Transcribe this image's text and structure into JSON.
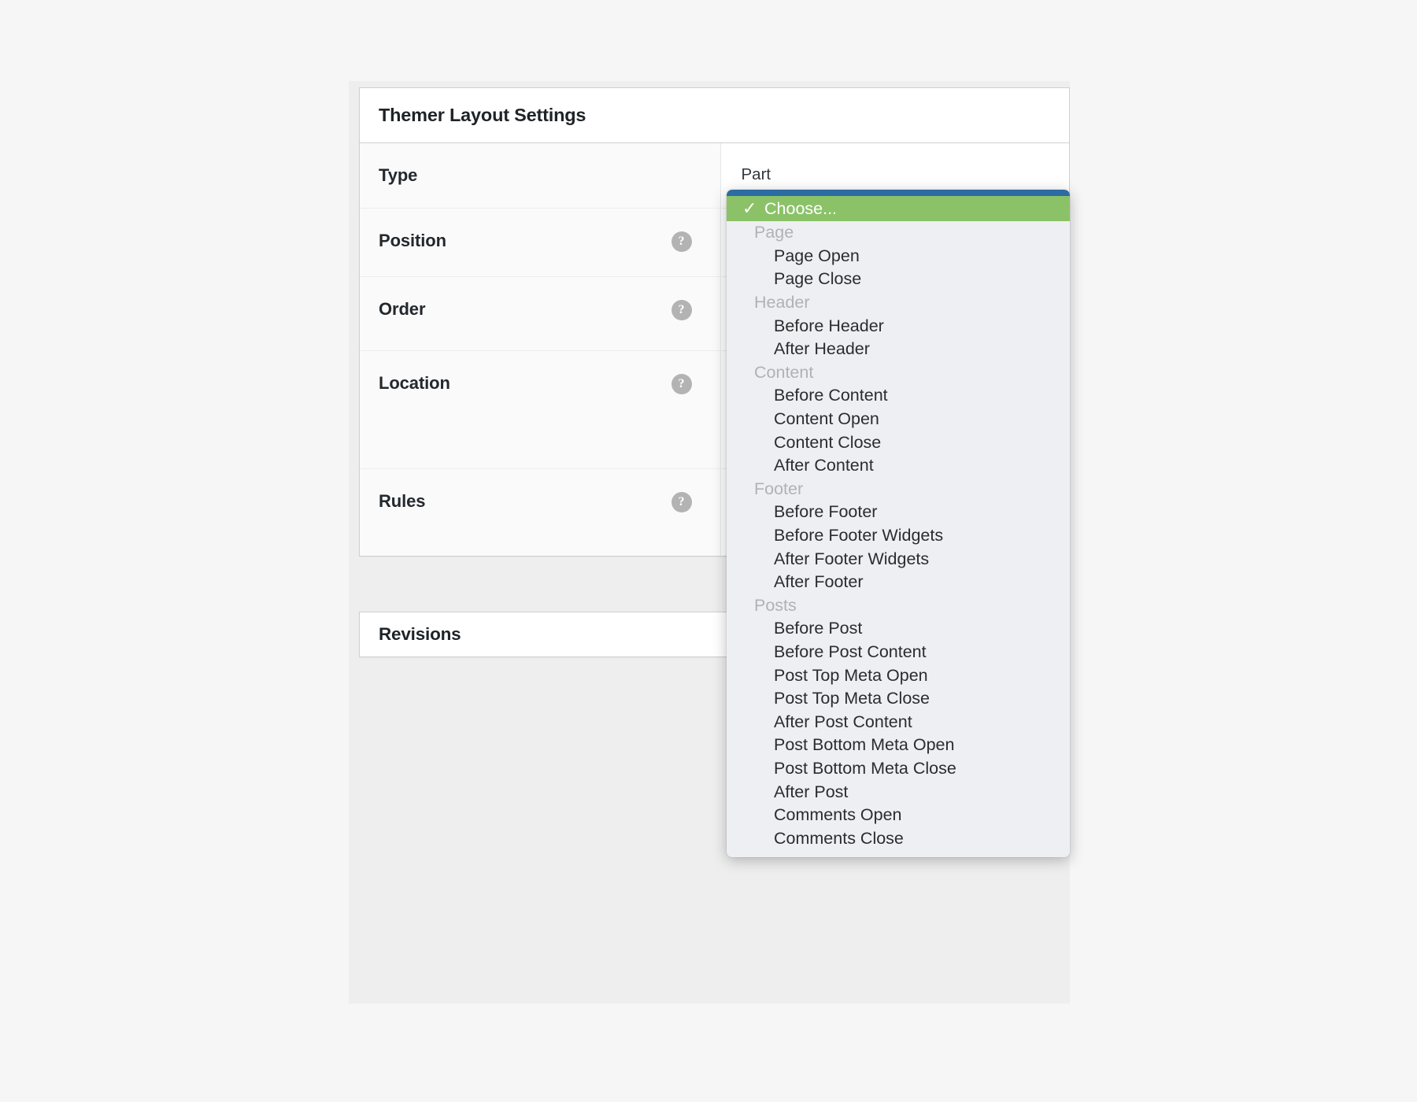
{
  "panel": {
    "title": "Themer Layout Settings",
    "rows": [
      {
        "label": "Type",
        "value": "Part",
        "has_help": false,
        "help_icon": "question-mark-circle-icon"
      },
      {
        "label": "Position",
        "value": "",
        "has_help": true,
        "help_icon": "question-mark-circle-icon"
      },
      {
        "label": "Order",
        "value": "",
        "has_help": true,
        "help_icon": "question-mark-circle-icon"
      },
      {
        "label": "Location",
        "value": "",
        "has_help": true,
        "help_icon": "question-mark-circle-icon"
      },
      {
        "label": "Rules",
        "value": "",
        "has_help": true,
        "help_icon": "question-mark-circle-icon"
      }
    ]
  },
  "revisions": {
    "title": "Revisions"
  },
  "dropdown": {
    "selected_label": "Choose...",
    "check_glyph": "✓",
    "options": [
      {
        "label": "Choose...",
        "type": "selected"
      },
      {
        "label": "Page",
        "type": "group"
      },
      {
        "label": "Page Open",
        "type": "item"
      },
      {
        "label": "Page Close",
        "type": "item"
      },
      {
        "label": "Header",
        "type": "group"
      },
      {
        "label": "Before Header",
        "type": "item"
      },
      {
        "label": "After Header",
        "type": "item"
      },
      {
        "label": "Content",
        "type": "group"
      },
      {
        "label": "Before Content",
        "type": "item"
      },
      {
        "label": "Content Open",
        "type": "item"
      },
      {
        "label": "Content Close",
        "type": "item"
      },
      {
        "label": "After Content",
        "type": "item"
      },
      {
        "label": "Footer",
        "type": "group"
      },
      {
        "label": "Before Footer",
        "type": "item"
      },
      {
        "label": "Before Footer Widgets",
        "type": "item"
      },
      {
        "label": "After Footer Widgets",
        "type": "item"
      },
      {
        "label": "After Footer",
        "type": "item"
      },
      {
        "label": "Posts",
        "type": "group"
      },
      {
        "label": "Before Post",
        "type": "item"
      },
      {
        "label": "Before Post Content",
        "type": "item"
      },
      {
        "label": "Post Top Meta Open",
        "type": "item"
      },
      {
        "label": "Post Top Meta Close",
        "type": "item"
      },
      {
        "label": "After Post Content",
        "type": "item"
      },
      {
        "label": "Post Bottom Meta Open",
        "type": "item"
      },
      {
        "label": "Post Bottom Meta Close",
        "type": "item"
      },
      {
        "label": "After Post",
        "type": "item"
      },
      {
        "label": "Comments Open",
        "type": "item"
      },
      {
        "label": "Comments Close",
        "type": "item"
      }
    ]
  },
  "colors": {
    "selected_bg": "#8bc268",
    "popup_topbar": "#2b6ca3",
    "popup_bg": "#eeeff2",
    "group_label": "#b0b2b5",
    "page_bg": "#f6f6f6",
    "help_icon_bg": "#b3b3b3"
  }
}
